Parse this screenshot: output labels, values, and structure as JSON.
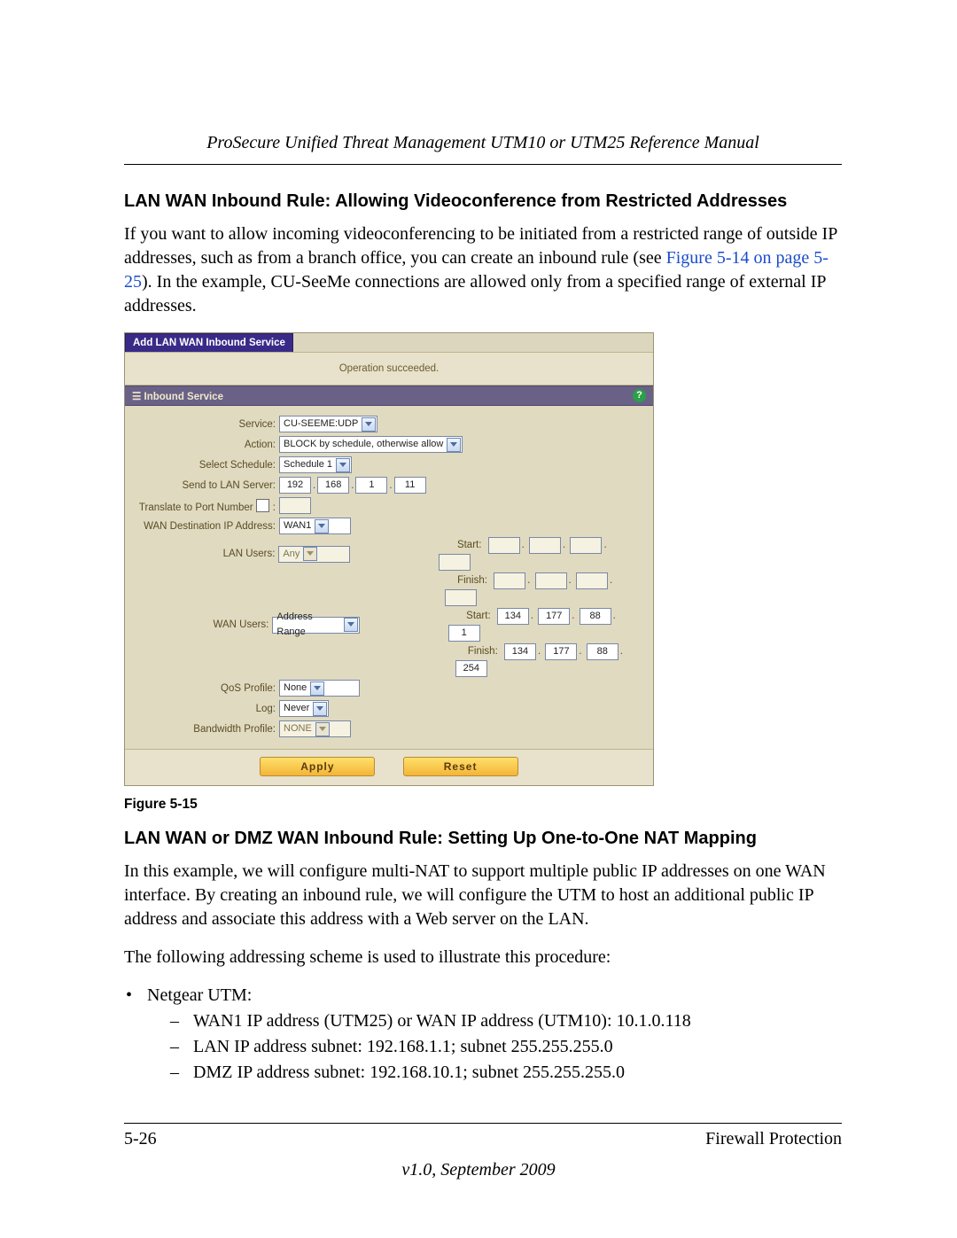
{
  "running_header": "ProSecure Unified Threat Management UTM10 or UTM25 Reference Manual",
  "section1": {
    "heading": "LAN WAN Inbound Rule: Allowing Videoconference from Restricted Addresses",
    "para_pre": "If you want to allow incoming videoconferencing to be initiated from a restricted range of outside IP addresses, such as from a branch office, you can create an inbound rule (see ",
    "xref": "Figure 5-14 on page 5-25",
    "para_post": "). In the example, CU-SeeMe connections are allowed only from a specified range of external IP addresses."
  },
  "figure": {
    "tab_title": "Add LAN WAN Inbound Service",
    "status_msg": "Operation succeeded.",
    "panel_title": "Inbound Service",
    "labels": {
      "service": "Service:",
      "action": "Action:",
      "schedule": "Select Schedule:",
      "send_to": "Send to LAN Server:",
      "translate": "Translate to Port Number",
      "translate_colon": ":",
      "wan_dest": "WAN Destination IP Address:",
      "lan_users": "LAN Users:",
      "wan_users": "WAN Users:",
      "qos": "QoS Profile:",
      "log": "Log:",
      "bw": "Bandwidth Profile:",
      "start": "Start:",
      "finish": "Finish:"
    },
    "values": {
      "service": "CU-SEEME:UDP",
      "action": "BLOCK by schedule, otherwise allow",
      "schedule": "Schedule 1",
      "send_ip": [
        "192",
        "168",
        "1",
        "11"
      ],
      "wan_dest": "WAN1",
      "lan_users": "Any",
      "lan_start": [
        "",
        "",
        "",
        ""
      ],
      "lan_finish": [
        "",
        "",
        "",
        ""
      ],
      "wan_users": "Address Range",
      "wan_start": [
        "134",
        "177",
        "88",
        "1"
      ],
      "wan_finish": [
        "134",
        "177",
        "88",
        "254"
      ],
      "qos": "None",
      "log": "Never",
      "bw": "NONE"
    },
    "buttons": {
      "apply": "Apply",
      "reset": "Reset"
    },
    "caption": "Figure 5-15"
  },
  "section2": {
    "heading": "LAN WAN or DMZ WAN Inbound Rule: Setting Up One-to-One NAT Mapping",
    "para1": "In this example, we will configure multi-NAT to support multiple public IP addresses on one WAN interface. By creating an inbound rule, we will configure the UTM to host an additional public IP address and associate this address with a Web server on the LAN.",
    "para2": "The following addressing scheme is used to illustrate this procedure:",
    "bullet1": "Netgear UTM:",
    "sub": [
      "WAN1 IP address (UTM25) or WAN IP address (UTM10): 10.1.0.118",
      "LAN IP address subnet: 192.168.1.1; subnet 255.255.255.0",
      "DMZ IP address subnet: 192.168.10.1; subnet 255.255.255.0"
    ]
  },
  "footer": {
    "left": "5-26",
    "right": "Firewall Protection",
    "version": "v1.0, September 2009"
  }
}
